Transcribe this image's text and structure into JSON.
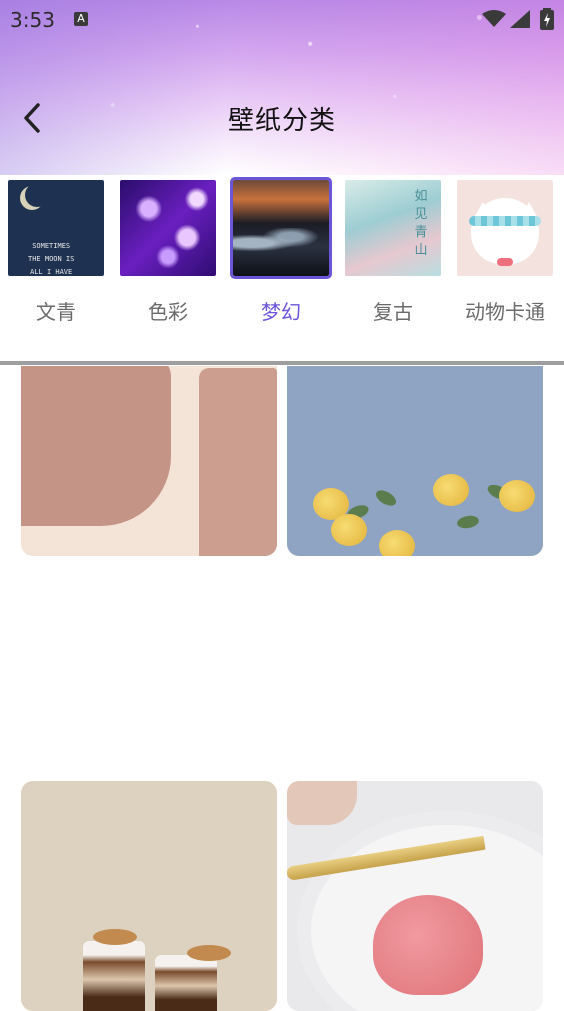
{
  "status_bar": {
    "time": "3:53",
    "notification_icon_letter": "A",
    "icons": [
      "wifi-icon",
      "signal-icon",
      "battery-charging-icon"
    ]
  },
  "header": {
    "title": "壁纸分类",
    "back_icon": "chevron-left-icon"
  },
  "categories": [
    {
      "label": "文青",
      "thumb_text": [
        "SOMETIMES",
        "THE MOON IS",
        "ALL I HAVE"
      ],
      "selected": false
    },
    {
      "label": "色彩",
      "selected": false
    },
    {
      "label": "梦幻",
      "selected": true
    },
    {
      "label": "复古",
      "thumb_text": [
        "如",
        "见",
        "青",
        "山"
      ],
      "selected": false
    },
    {
      "label": "动物卡通",
      "selected": false
    }
  ],
  "colors": {
    "accent": "#6a55d8",
    "label_default": "#6b6b6b",
    "title": "#111111",
    "divider": "#9e9e9e"
  },
  "wallpapers": [
    {
      "name": "beige-abstract-shapes"
    },
    {
      "name": "yellow-roses-blue-sky"
    },
    {
      "name": "coffee-cups-cookies"
    },
    {
      "name": "pink-heart-cake"
    }
  ]
}
